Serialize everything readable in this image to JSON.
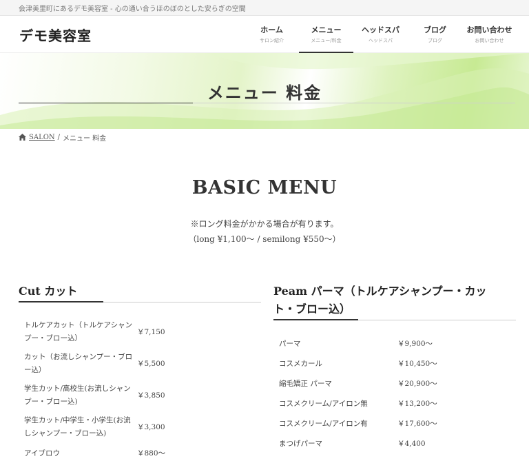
{
  "topbar": {
    "text": "会津美里町にあるデモ美容室 - 心の通い合うほのぼのとした安らぎの空間"
  },
  "header": {
    "logo": "デモ美容室",
    "nav": [
      {
        "label": "ホーム",
        "sub": "サロン紹介"
      },
      {
        "label": "メニュー",
        "sub": "メニュー/料金"
      },
      {
        "label": "ヘッドスパ",
        "sub": "ヘッドスパ"
      },
      {
        "label": "ブログ",
        "sub": "ブログ"
      },
      {
        "label": "お問い合わせ",
        "sub": "お問い合わせ"
      }
    ]
  },
  "hero": {
    "title": "メニュー 料金"
  },
  "breadcrumb": {
    "home": "SALON",
    "separator": "/",
    "current": "メニュー 料金"
  },
  "basic": {
    "title": "BASIC MENU",
    "note1": "※ロング料金がかかる場合が有ります。",
    "note2": "（long ¥1,100～ / semilong ¥550～）"
  },
  "cut": {
    "title": "Cut カット",
    "items": [
      {
        "name": "トルケアカット（トルケアシャンプー・ブロー込）",
        "price": "￥7,150"
      },
      {
        "name": "カット（お流しシャンプー・ブロー込）",
        "price": "￥5,500"
      },
      {
        "name": "学生カット/高校生(お流しシャンプー・ブロー込)",
        "price": "￥3,850"
      },
      {
        "name": "学生カット/中学生・小学生(お流しシャンプー・ブロー込)",
        "price": "￥3,300"
      },
      {
        "name": "アイブロウ",
        "price": "￥880～"
      }
    ]
  },
  "perm": {
    "title_line1": "Peam パーマ（トルケアシャンプー・カッ",
    "title_line2": "ト・ブロー込）",
    "items": [
      {
        "name": "パーマ",
        "price": "￥9,900～"
      },
      {
        "name": "コスメカール",
        "price": "￥10,450～"
      },
      {
        "name": "縮毛矯正 パーマ",
        "price": "￥20,900～"
      },
      {
        "name": "コスメクリーム/アイロン無",
        "price": "￥13,200～"
      },
      {
        "name": "コスメクリーム/アイロン有",
        "price": "￥17,600～"
      },
      {
        "name": "まつげパーマ",
        "price": "￥4,400"
      }
    ]
  }
}
